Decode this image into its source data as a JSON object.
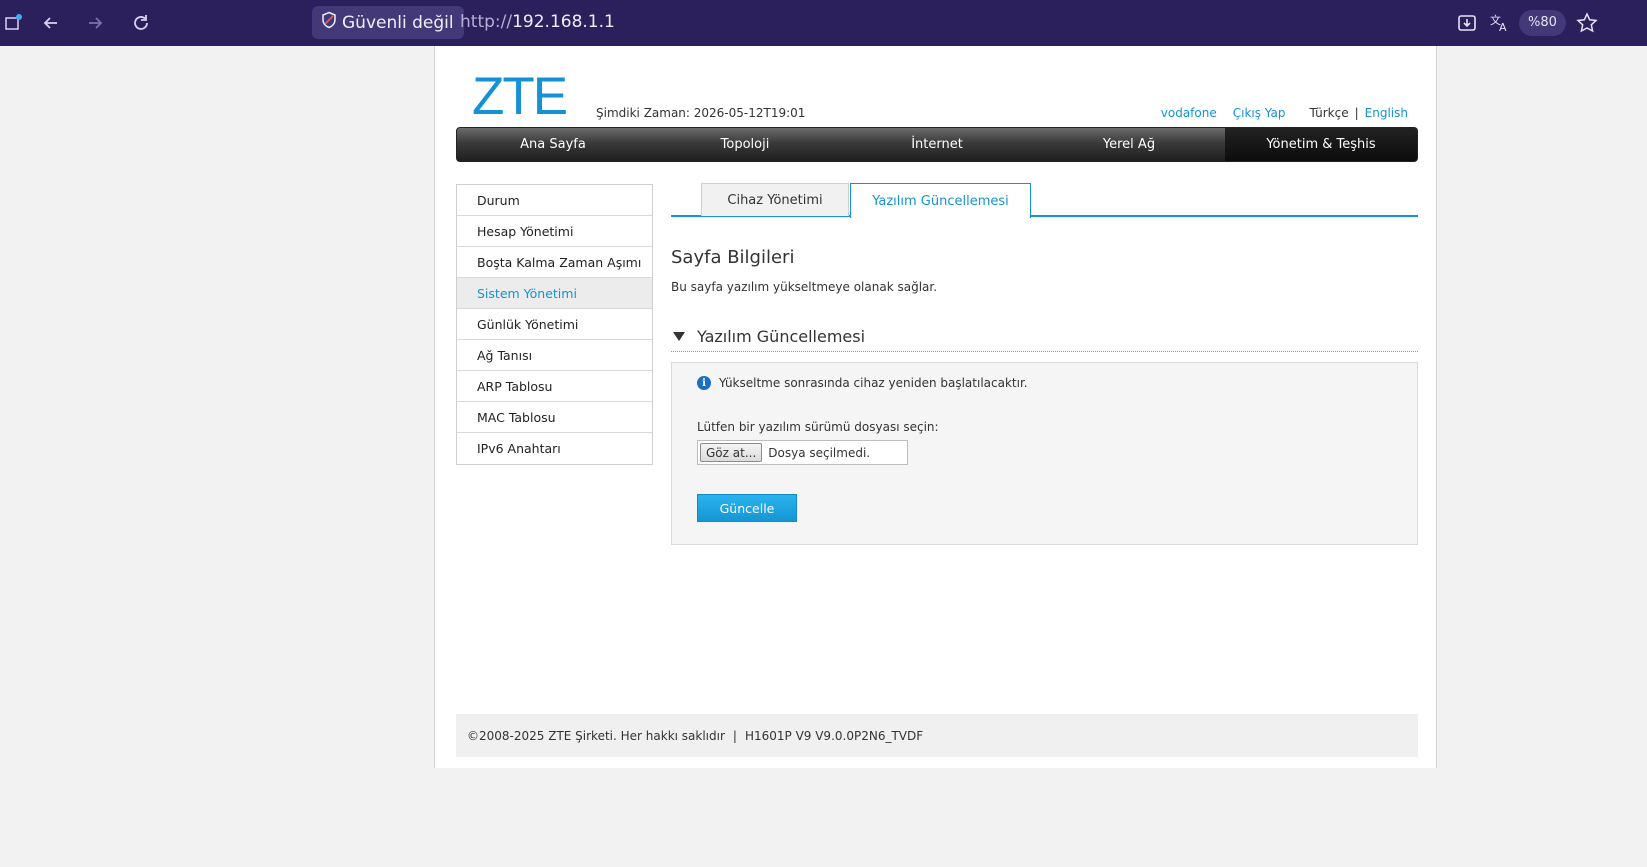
{
  "browser": {
    "security_label": "Güvenli değil",
    "url_scheme": "http://",
    "url_host": "192.168.1.1",
    "zoom": "%80",
    "icons": [
      "tab-icon",
      "back-icon",
      "forward-icon",
      "reload-icon",
      "shield-icon",
      "download-icon",
      "translate-icon",
      "star-icon"
    ]
  },
  "header": {
    "logo": "ZTE",
    "current_time": "Şimdiki Zaman: 2026-05-12T19:01",
    "links": {
      "provider": "vodafone",
      "logout": "Çıkış Yap",
      "lang_tr": "Türkçe",
      "separator": "|",
      "lang_en": "English"
    }
  },
  "mainnav": {
    "items": [
      "Ana Sayfa",
      "Topoloji",
      "İnternet",
      "Yerel Ağ",
      "Yönetim & Teşhis"
    ],
    "active": "Yönetim & Teşhis"
  },
  "sidebar": {
    "items": [
      "Durum",
      "Hesap Yönetimi",
      "Boşta Kalma Zaman Aşımı",
      "Sistem Yönetimi",
      "Günlük Yönetimi",
      "Ağ Tanısı",
      "ARP Tablosu",
      "MAC Tablosu",
      "IPv6 Anahtarı"
    ],
    "active": "Sistem Yönetimi"
  },
  "tabs": {
    "device_mgmt": "Cihaz Yönetimi",
    "software_update": "Yazılım Güncellemesi"
  },
  "content": {
    "title": "Sayfa Bilgileri",
    "description": "Bu sayfa yazılım yükseltmeye olanak sağlar.",
    "section_title": "Yazılım Güncellemesi",
    "info_note": "Yükseltme sonrasında cihaz yeniden başlatılacaktır.",
    "select_label": "Lütfen bir yazılım sürümü dosyası seçin:",
    "browse_button": "Göz at...",
    "file_status": "Dosya seçilmedi.",
    "update_button": "Güncelle"
  },
  "footer": {
    "copyright": "©2008-2025 ZTE Şirketi. Her hakkı saklıdır",
    "separator": "|",
    "version": "H1601P V9 V9.0.0P2N6_TVDF"
  },
  "colors": {
    "accent": "#1592d6",
    "browser_bar": "#2b1f5c"
  }
}
